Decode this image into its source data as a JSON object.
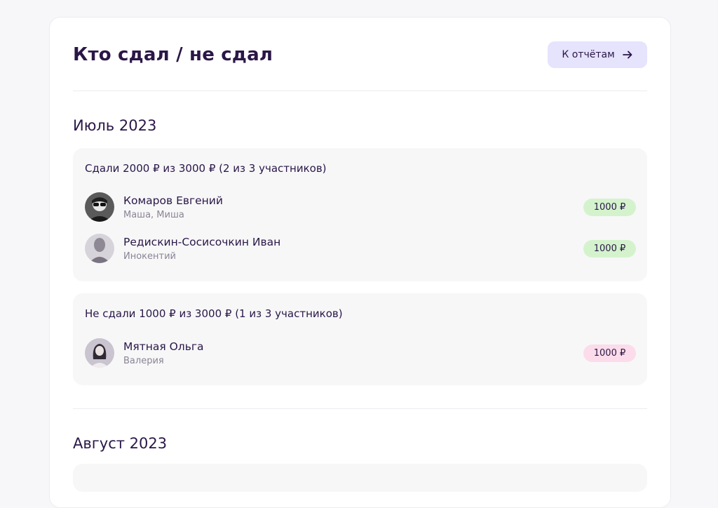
{
  "header": {
    "title": "Кто сдал / не сдал",
    "reports_button": "К отчётам",
    "reports_icon": "arrow-right-icon"
  },
  "months": [
    {
      "title": "Июль 2023",
      "groups": [
        {
          "status": "paid",
          "title": "Сдали 2000 ₽ из 3000 ₽ (2 из 3 участников)",
          "people": [
            {
              "name": "Комаров Евгений",
              "sub": "Маша, Миша",
              "amount": "1000 ₽"
            },
            {
              "name": "Редискин-Сосисочкин Иван",
              "sub": "Инокентий",
              "amount": "1000 ₽"
            }
          ]
        },
        {
          "status": "unpaid",
          "title": "Не сдали 1000 ₽ из 3000 ₽ (1 из 3 участников)",
          "people": [
            {
              "name": "Мятная Ольга",
              "sub": "Валерия",
              "amount": "1000 ₽"
            }
          ]
        }
      ]
    },
    {
      "title": "Август 2023",
      "groups": []
    }
  ],
  "colors": {
    "accent_button": "#e6e3fd",
    "paid_badge": "#d4f3cd",
    "unpaid_badge": "#fcdcea",
    "text": "#2a1747"
  }
}
